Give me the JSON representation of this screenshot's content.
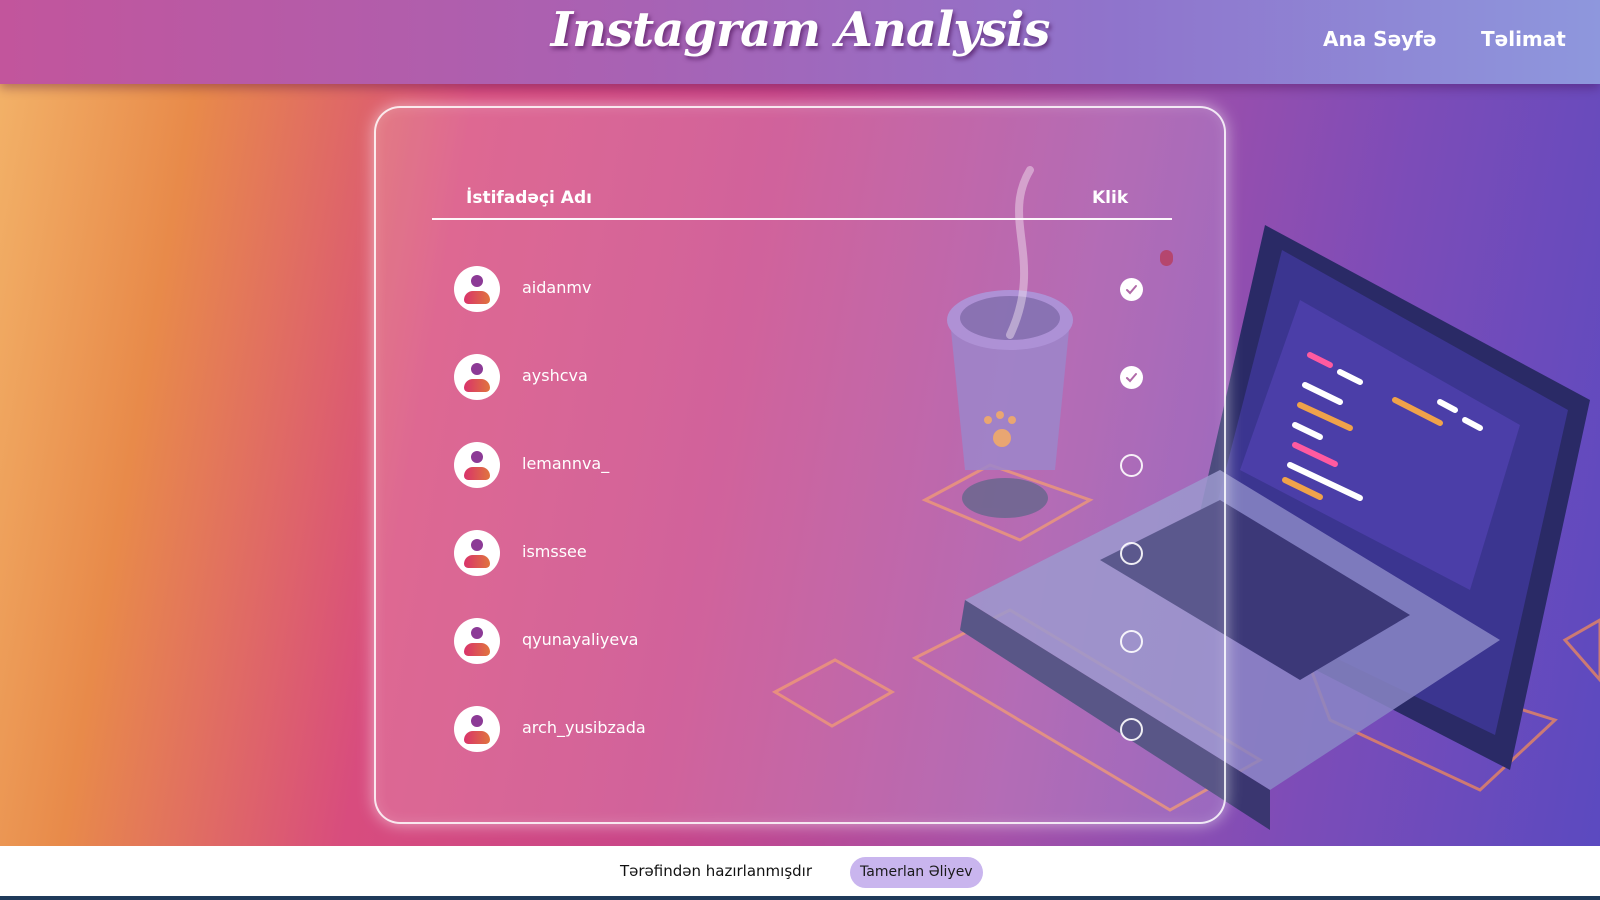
{
  "header": {
    "logo": "Instagram Analysis",
    "nav": [
      {
        "label": "Ana Səyfə"
      },
      {
        "label": "Təlimat"
      }
    ]
  },
  "table": {
    "col_user": "İstifadəçi Adı",
    "col_click": "Klik",
    "rows": [
      {
        "username": "aidanmv",
        "checked": true
      },
      {
        "username": "ayshcva",
        "checked": true
      },
      {
        "username": "lemannva_",
        "checked": false
      },
      {
        "username": "ismssee",
        "checked": false
      },
      {
        "username": "qyunayaliyeva",
        "checked": false
      },
      {
        "username": "arch_yusibzada",
        "checked": false
      }
    ]
  },
  "footer": {
    "credit": "Tərəfindən hazırlanmışdır",
    "author": "Tamerlan Əliyev"
  },
  "colors": {
    "accent": "#c9b5ee",
    "avatar_head": "#8c3a96"
  }
}
